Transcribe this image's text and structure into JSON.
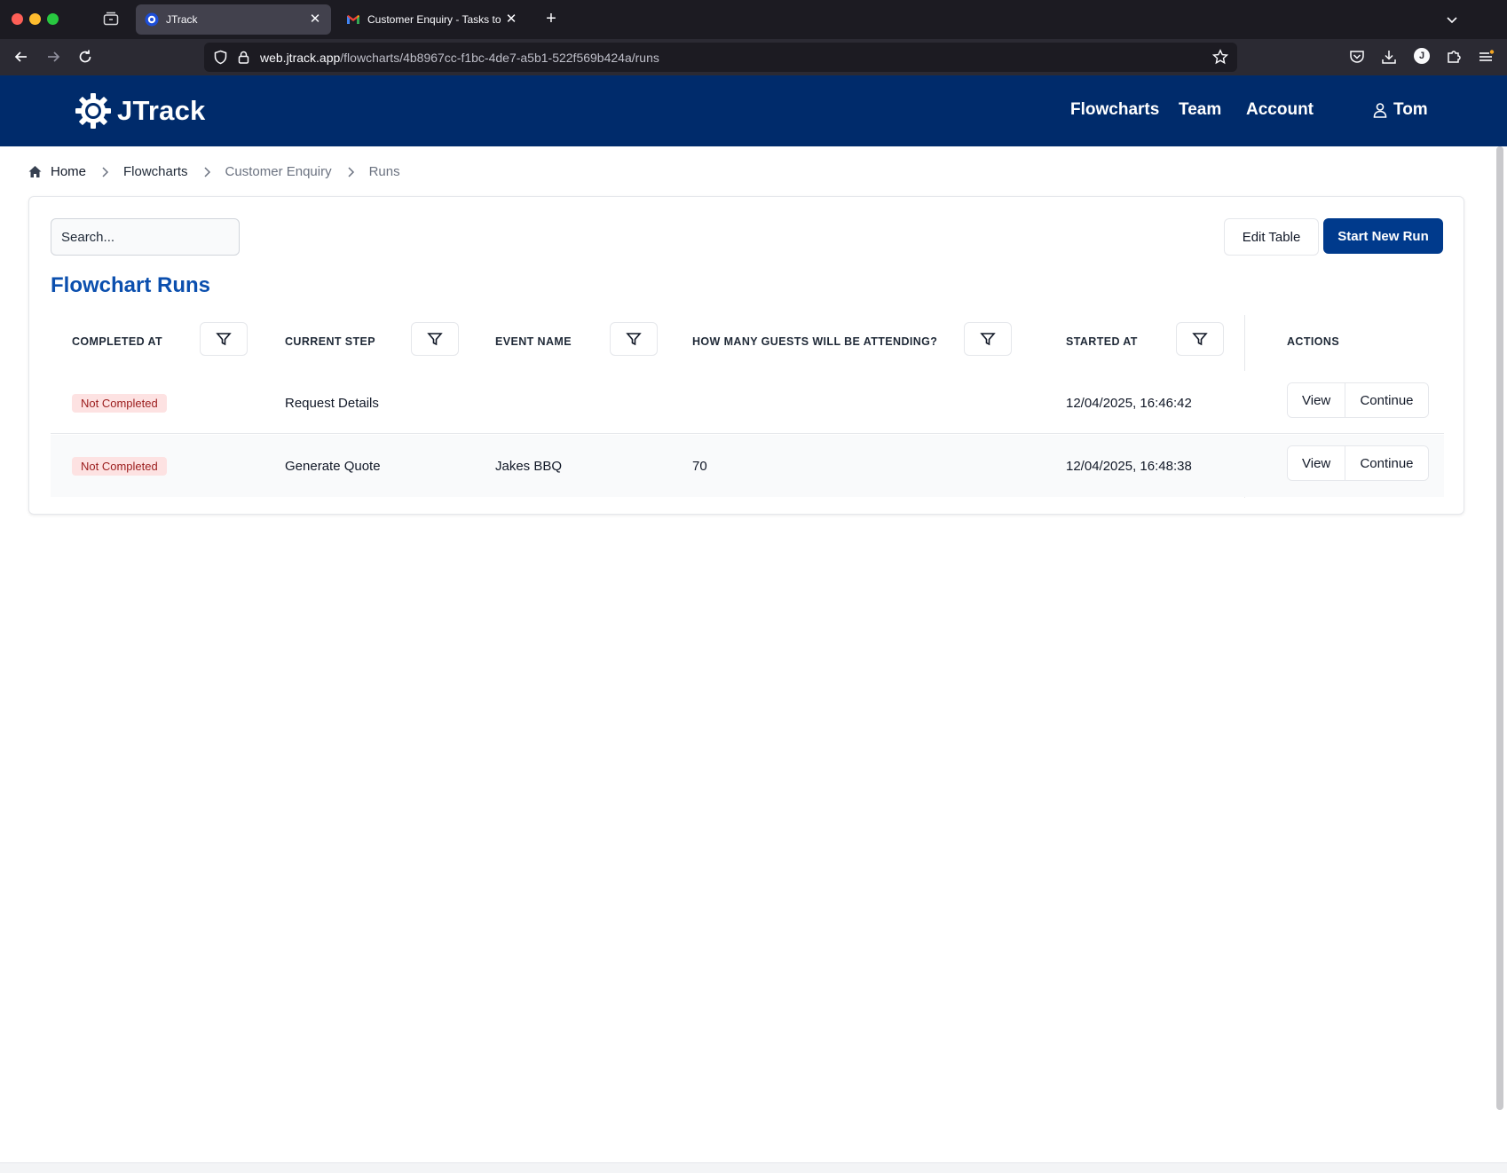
{
  "browser": {
    "tabs": [
      {
        "title": "JTrack",
        "active": true
      },
      {
        "title": "Customer Enquiry - Tasks to co",
        "active": false
      }
    ],
    "url_host": "web.jtrack.app",
    "url_path": "/flowcharts/4b8967cc-f1bc-4de7-a5b1-522f569b424a/runs",
    "profile_initial": "J"
  },
  "header": {
    "brand": "JTrack",
    "nav": [
      "Flowcharts",
      "Team",
      "Account"
    ],
    "user": "Tom",
    "bg_color": "#002b6b"
  },
  "breadcrumb": [
    "Home",
    "Flowcharts",
    "Customer Enquiry",
    "Runs"
  ],
  "toolbar": {
    "search_placeholder": "Search...",
    "edit_label": "Edit Table",
    "start_label": "Start New Run",
    "accent_color": "#003a8c"
  },
  "title": "Flowchart Runs",
  "table": {
    "columns": [
      "Completed At",
      "Current Step",
      "Event Name",
      "How Many Guests Will Be Attending?",
      "Started At",
      "Actions"
    ],
    "rows": [
      {
        "completed": "Not Completed",
        "step": "Request Details",
        "event": "",
        "guests": "",
        "started": "12/04/2025, 16:46:42"
      },
      {
        "completed": "Not Completed",
        "step": "Generate Quote",
        "event": "Jakes BBQ",
        "guests": "70",
        "started": "12/04/2025, 16:48:38"
      }
    ],
    "view_label": "View",
    "continue_label": "Continue"
  }
}
